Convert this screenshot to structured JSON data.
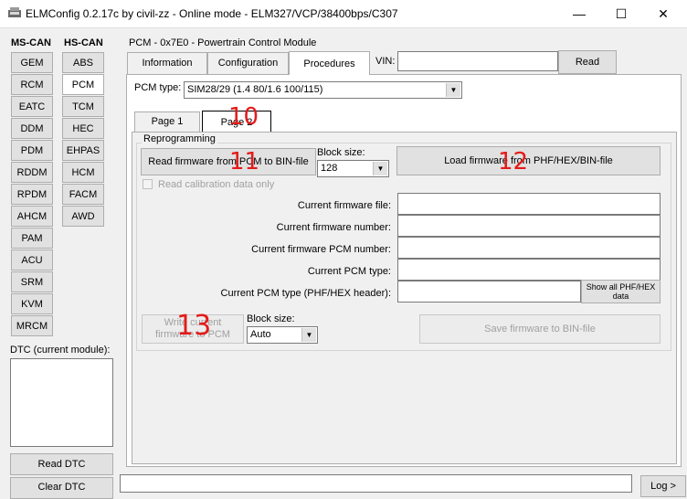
{
  "window": {
    "title": "ELMConfig 0.2.17c by civil-zz - Online mode - ELM327/VCP/38400bps/C307",
    "minimize_glyph": "—",
    "maximize_glyph": "☐",
    "close_glyph": "✕"
  },
  "left_panel": {
    "ms_can_header": "MS-CAN",
    "hs_can_header": "HS-CAN",
    "ms_can_modules": [
      "GEM",
      "RCM",
      "EATC",
      "DDM",
      "PDM",
      "RDDM",
      "RPDM",
      "AHCM",
      "PAM",
      "ACU",
      "SRM",
      "KVM",
      "MRCM"
    ],
    "hs_can_modules": [
      "ABS",
      "PCM",
      "TCM",
      "HEC",
      "EHPAS",
      "HCM",
      "FACM",
      "AWD"
    ],
    "selected_module": "PCM",
    "dtc_label": "DTC (current module):",
    "read_dtc_label": "Read DTC",
    "clear_dtc_label": "Clear DTC"
  },
  "main": {
    "module_header": "PCM - 0x7E0 - Powertrain Control Module",
    "tabs": [
      {
        "label": "Information",
        "active": false
      },
      {
        "label": "Configuration",
        "active": false
      },
      {
        "label": "Procedures",
        "active": true
      }
    ],
    "vin_label": "VIN:",
    "vin_value": "",
    "read_button": "Read",
    "pcm_type_label": "PCM type:",
    "pcm_type_value": "SIM28/29 (1.4 80/1.6 100/115)",
    "page_tabs": [
      {
        "label": "Page 1",
        "active": false
      },
      {
        "label": "Page 2",
        "active": true
      }
    ],
    "reprogramming": {
      "group_label": "Reprogramming",
      "read_firmware_button": "Read firmware from PCM to BIN-file",
      "block_size_label": "Block size:",
      "block_size_value": "128",
      "load_firmware_button": "Load firmware from PHF/HEX/BIN-file",
      "read_calibration_label": "Read calibration data only",
      "fields": [
        {
          "label": "Current firmware file:",
          "value": ""
        },
        {
          "label": "Current firmware number:",
          "value": ""
        },
        {
          "label": "Current firmware PCM number:",
          "value": ""
        },
        {
          "label": "Current PCM type:",
          "value": ""
        },
        {
          "label": "Current PCM type (PHF/HEX header):",
          "value": ""
        }
      ],
      "show_all_button": "Show all PHF/HEX data",
      "write_firmware_button": "Write current firmware to PCM",
      "block_size2_label": "Block size:",
      "block_size2_value": "Auto",
      "save_firmware_button": "Save firmware to BIN-file"
    },
    "log_button": "Log >"
  },
  "annotations": [
    "10",
    "11",
    "12",
    "13"
  ],
  "colors": {
    "annotation": "#e51a1a",
    "window_bg": "#f0f0f0",
    "button_face": "#e1e1e1"
  }
}
